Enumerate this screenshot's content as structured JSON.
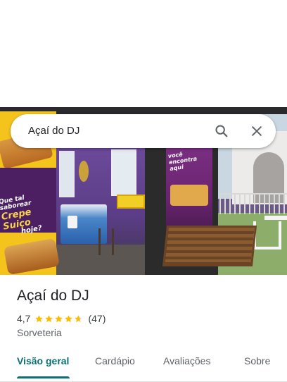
{
  "search": {
    "query": "Açaí do DJ",
    "search_icon": "search-icon",
    "close_icon": "close-icon"
  },
  "hero_photo": {
    "banner_text": [
      "Que tal saborear",
      "Crepe Suiço",
      "hoje?"
    ],
    "poster_text": [
      "você",
      "encontra",
      "aqui"
    ]
  },
  "place": {
    "name": "Açaí do DJ",
    "rating_text": "4,7",
    "rating_value": 4.7,
    "stars_max": 5,
    "review_count": "(47)",
    "category": "Sorveteria"
  },
  "tabs": [
    {
      "label": "Visão geral",
      "active": true
    },
    {
      "label": "Cardápio",
      "active": false
    },
    {
      "label": "Avaliações",
      "active": false
    },
    {
      "label": "Sobre",
      "active": false
    }
  ],
  "colors": {
    "accent": "#0b6f73",
    "star": "#fbbc04",
    "text_primary": "#202124",
    "text_secondary": "#5f6368"
  }
}
